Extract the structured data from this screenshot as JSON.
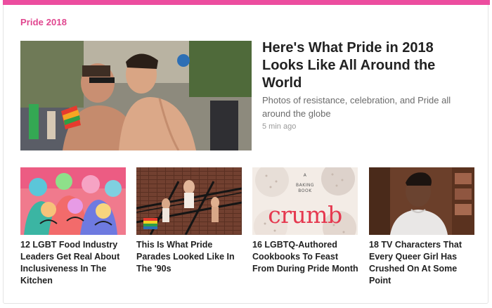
{
  "section": {
    "title": "Pride 2018"
  },
  "hero": {
    "title": "Here's What Pride in 2018 Looks Like All Around the World",
    "subtitle": "Photos of resistance, celebration, and Pride all around the globe",
    "time": "5 min ago"
  },
  "stories": [
    {
      "title": "12 LGBT Food Industry Leaders Get Real About Inclusiveness In The Kitchen"
    },
    {
      "title": "This Is What Pride Parades Looked Like In The '90s"
    },
    {
      "title": "16 LGBTQ-Authored Cookbooks To Feast From During Pride Month"
    },
    {
      "title": "18 TV Characters That Every Queer Girl Has Crushed On At Some Point"
    }
  ],
  "cookbook": {
    "top_label": "A",
    "label_line1": "BAKING",
    "label_line2": "BOOK",
    "title": "crumb"
  },
  "colors": {
    "accent": "#ec4d9f",
    "section_title": "#e0468f",
    "headline": "#222222",
    "muted": "#6b6b6b"
  }
}
